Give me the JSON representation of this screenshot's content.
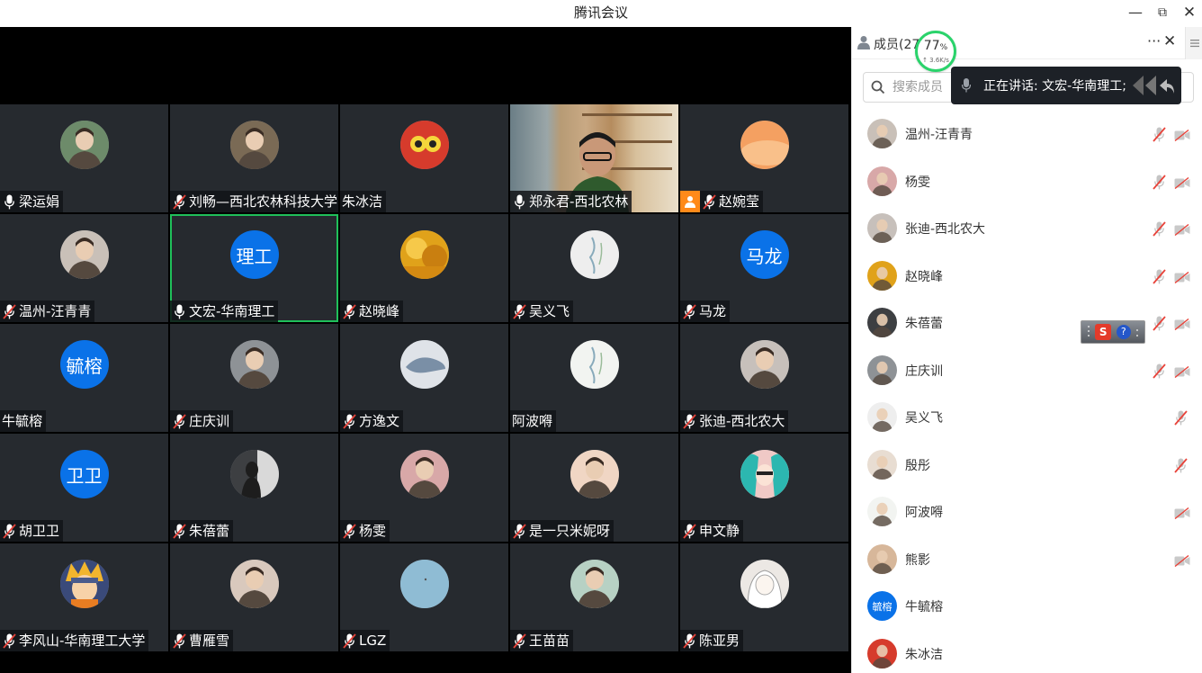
{
  "window": {
    "title": "腾讯会议",
    "minimize": "—",
    "restore": "⧉",
    "close": "✕"
  },
  "tiles": [
    {
      "name": "梁运娟",
      "mic": "on",
      "avatar": "photo-lake",
      "color": "#6d8b6a"
    },
    {
      "name": "刘畅—西北农林科技大学",
      "mic": "muted",
      "avatar": "photo-cartoon",
      "color": "#7a6a55"
    },
    {
      "name": "朱冰洁",
      "mic": "none",
      "avatar": "photo-red-mask",
      "color": "#d63b2c"
    },
    {
      "name": "郑永君-西北农林",
      "mic": "on",
      "avatar": "camera",
      "color": "#b79b75"
    },
    {
      "name": "赵婉莹",
      "mic": "muted",
      "avatar": "photo-orange",
      "color": "#f4a061",
      "host": true
    },
    {
      "name": "温州-汪青青",
      "mic": "muted",
      "avatar": "photo-girl",
      "color": "#c9c0b8"
    },
    {
      "name": "文宏-华南理工",
      "mic": "on",
      "avatar_text": "理工",
      "active": true
    },
    {
      "name": "赵晓峰",
      "mic": "muted",
      "avatar": "photo-ginkgo",
      "color": "#e0a21a"
    },
    {
      "name": "吴义飞",
      "mic": "muted",
      "avatar": "photo-calligraphy",
      "color": "#eeeeee"
    },
    {
      "name": "马龙",
      "mic": "muted",
      "avatar_text": "马龙"
    },
    {
      "name": "牛毓榕",
      "mic": "none",
      "avatar_text": "毓榕"
    },
    {
      "name": "庄庆训",
      "mic": "muted",
      "avatar": "photo-gray",
      "color": "#8e9296"
    },
    {
      "name": "方逸文",
      "mic": "muted",
      "avatar": "photo-dolphin",
      "color": "#dfe3e8"
    },
    {
      "name": "阿波嘚",
      "mic": "none",
      "avatar": "photo-sketch",
      "color": "#f2f4f1"
    },
    {
      "name": "张迪-西北农大",
      "mic": "muted",
      "avatar": "photo-boy",
      "color": "#c7c0bb"
    },
    {
      "name": "胡卫卫",
      "mic": "muted",
      "avatar_text": "卫卫"
    },
    {
      "name": "朱蓓蕾",
      "mic": "muted",
      "avatar": "photo-silhouette",
      "color": "#3d3f42"
    },
    {
      "name": "杨雯",
      "mic": "muted",
      "avatar": "photo-pink",
      "color": "#d8a8a8"
    },
    {
      "name": "是一只米妮呀",
      "mic": "muted",
      "avatar": "photo-anime-girl",
      "color": "#f0d6c4"
    },
    {
      "name": "申文静",
      "mic": "muted",
      "avatar": "photo-anime-teal",
      "color": "#2cb7b0"
    },
    {
      "name": "李风山-华南理工大学",
      "mic": "muted",
      "avatar": "photo-naruto",
      "color": "#e5a431"
    },
    {
      "name": "曹雁雪",
      "mic": "muted",
      "avatar": "photo-portrait",
      "color": "#d9c9bd"
    },
    {
      "name": "LGZ",
      "mic": "muted",
      "avatar": "photo-sky",
      "color": "#8fbcd4"
    },
    {
      "name": "王苗苗",
      "mic": "muted",
      "avatar": "photo-baby",
      "color": "#b7d1c4"
    },
    {
      "name": "陈亚男",
      "mic": "muted",
      "avatar": "photo-sketch-girl",
      "color": "#ece8e4"
    }
  ],
  "panel": {
    "title": "成员(27)",
    "more": "···",
    "close": "✕",
    "network": {
      "percent": "77",
      "unit": "%",
      "speed": "↑ 3.6K/s"
    },
    "search_placeholder": "搜索成员",
    "speaking": "正在讲话: 文宏-华南理工;",
    "members": [
      {
        "name": "温州-汪青青",
        "mic": "muted",
        "cam": "off",
        "color": "#c9c0b8"
      },
      {
        "name": "杨雯",
        "mic": "muted",
        "cam": "off",
        "color": "#d8a8a8"
      },
      {
        "name": "张迪-西北农大",
        "mic": "muted",
        "cam": "off",
        "color": "#c7c0bb"
      },
      {
        "name": "赵晓峰",
        "mic": "muted",
        "cam": "off",
        "color": "#e0a21a"
      },
      {
        "name": "朱蓓蕾",
        "mic": "muted",
        "cam": "off",
        "color": "#3d3f42"
      },
      {
        "name": "庄庆训",
        "mic": "muted",
        "cam": "off",
        "color": "#8e9296"
      },
      {
        "name": "吴义飞",
        "mic": "muted",
        "cam": "none",
        "color": "#eeeeee"
      },
      {
        "name": "殷彤",
        "mic": "muted",
        "cam": "none",
        "color": "#e8ddd2"
      },
      {
        "name": "阿波嘚",
        "mic": "none",
        "cam": "off",
        "color": "#f2f4f1"
      },
      {
        "name": "熊影",
        "mic": "none",
        "cam": "off",
        "color": "#d7b79a"
      },
      {
        "name": "牛毓榕",
        "mic": "none",
        "cam": "none",
        "avatar_text": "毓榕"
      },
      {
        "name": "朱冰洁",
        "mic": "none",
        "cam": "none",
        "color": "#d63b2c"
      }
    ]
  },
  "ime": {
    "logo": "S",
    "help": "?"
  }
}
